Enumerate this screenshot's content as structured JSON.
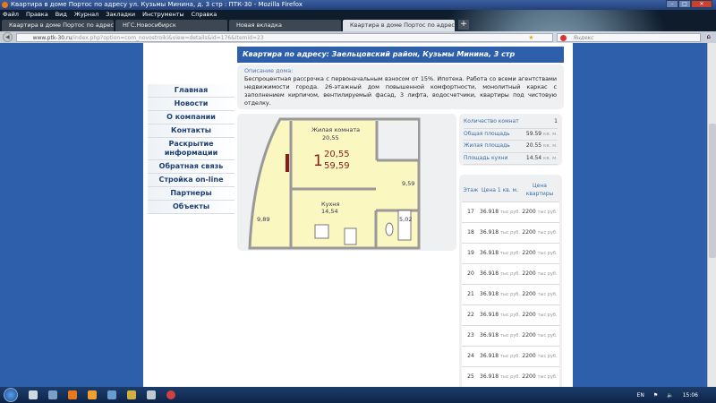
{
  "window": {
    "title": "Квартира в доме Портос по адресу ул. Кузьмы Минина, д. 3 стр : ПТК-30 - Mozilla Firefox"
  },
  "menu": [
    "Файл",
    "Правка",
    "Вид",
    "Журнал",
    "Закладки",
    "Инструменты",
    "Справка"
  ],
  "tabs": [
    "Квартира в доме Портос по адресу ...",
    "НГС.Новосибирск",
    "Новая вкладка",
    "Квартира в доме Портос по адресу ..."
  ],
  "address": {
    "domain": "www.ptk-30.ru",
    "path": "/index.php?option=com_novostroiki&view=details&id=176&Itemid=23"
  },
  "search": {
    "placeholder": "Яндекс"
  },
  "nav": [
    "Главная",
    "Новости",
    "О компании",
    "Контакты",
    "Раскрытие информации",
    "Обратная связь",
    "Стройка on-line",
    "Партнеры",
    "Объекты"
  ],
  "header": "Квартира по адресу: Заельцовский район, Кузьмы Минина, 3 стр",
  "description": {
    "label": "Описание дома:",
    "text": "Беспроцентная рассрочка с первоначальным взносом от 15%. Ипотека. Работа со всеми агентствами недвижимости города. 26-этажный дом повышенной комфортности, монолитный каркас с заполнением кирпичом, вентилируемый фасад, 3 лифта, водосчетчики, квартиры под чистовую отделку."
  },
  "plan": {
    "living_label": "Жилая комната",
    "living": "20,55",
    "rooms": "1",
    "area_living": "20,55",
    "area_total": "59,59",
    "hall": "9,59",
    "kitchen_label": "Кухня",
    "kitchen": "14,54",
    "balcony": "9,89",
    "bath": "5,02"
  },
  "info": [
    {
      "label": "Количество комнат",
      "value": "1",
      "unit": ""
    },
    {
      "label": "Общая площадь",
      "value": "59.59",
      "unit": "кв. м."
    },
    {
      "label": "Жилая площадь",
      "value": "20.55",
      "unit": "кв. м."
    },
    {
      "label": "Площадь кухни",
      "value": "14.54",
      "unit": "кв. м."
    }
  ],
  "prices": {
    "headers": [
      "Этаж",
      "Цена 1 кв. м.",
      "Цена квартиры"
    ],
    "rows": [
      {
        "floor": "17",
        "sqm": "36.918",
        "total": "2200"
      },
      {
        "floor": "18",
        "sqm": "36.918",
        "total": "2200"
      },
      {
        "floor": "19",
        "sqm": "36.918",
        "total": "2200"
      },
      {
        "floor": "20",
        "sqm": "36.918",
        "total": "2200"
      },
      {
        "floor": "21",
        "sqm": "36.918",
        "total": "2200"
      },
      {
        "floor": "22",
        "sqm": "36.918",
        "total": "2200"
      },
      {
        "floor": "23",
        "sqm": "36.918",
        "total": "2200"
      },
      {
        "floor": "24",
        "sqm": "36.918",
        "total": "2200"
      },
      {
        "floor": "25",
        "sqm": "36.918",
        "total": "2200"
      }
    ],
    "unit": "тыс руб."
  },
  "taskbar": {
    "lang": "EN",
    "time": "15:06"
  }
}
